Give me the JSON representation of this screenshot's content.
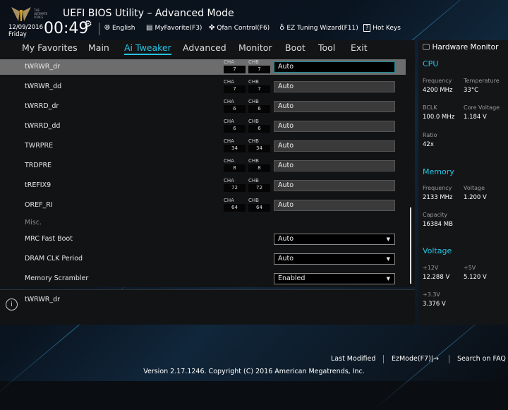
{
  "header": {
    "title": "UEFI BIOS Utility – Advanced Mode",
    "date": "12/09/2016",
    "day": "Friday",
    "time": "00:49",
    "toolbar": [
      {
        "label": "English",
        "icon": "globe-icon"
      },
      {
        "label": "MyFavorite(F3)",
        "icon": "favorite-list-icon"
      },
      {
        "label": "Qfan Control(F6)",
        "icon": "fan-icon"
      },
      {
        "label": "EZ Tuning Wizard(F11)",
        "icon": "lightbulb-icon"
      },
      {
        "label": "Hot Keys",
        "icon": "question-icon"
      }
    ]
  },
  "nav": {
    "tabs": [
      "My Favorites",
      "Main",
      "Ai Tweaker",
      "Advanced",
      "Monitor",
      "Boot",
      "Tool",
      "Exit"
    ],
    "active": "Ai Tweaker"
  },
  "rows": [
    {
      "label": "tWRWR_dr",
      "cha": "7",
      "chb": "7",
      "value": "Auto"
    },
    {
      "label": "tWRWR_dd",
      "cha": "7",
      "chb": "7",
      "value": "Auto"
    },
    {
      "label": "tWRRD_dr",
      "cha": "6",
      "chb": "6",
      "value": "Auto"
    },
    {
      "label": "tWRRD_dd",
      "cha": "6",
      "chb": "6",
      "value": "Auto"
    },
    {
      "label": "TWRPRE",
      "cha": "34",
      "chb": "34",
      "value": "Auto"
    },
    {
      "label": "TRDPRE",
      "cha": "8",
      "chb": "8",
      "value": "Auto"
    },
    {
      "label": "tREFIX9",
      "cha": "72",
      "chb": "72",
      "value": "Auto"
    },
    {
      "label": "OREF_RI",
      "cha": "64",
      "chb": "64",
      "value": "Auto"
    }
  ],
  "cha_label": "CHA",
  "chb_label": "CHB",
  "misc": "Misc.",
  "dropdowns": [
    {
      "label": "MRC Fast Boot",
      "value": "Auto"
    },
    {
      "label": "DRAM CLK Period",
      "value": "Auto"
    },
    {
      "label": "Memory Scrambler",
      "value": "Enabled"
    }
  ],
  "help": "tWRWR_dr",
  "hw": {
    "title": "Hardware Monitor",
    "cpu": {
      "title": "CPU",
      "frequency_label": "Frequency",
      "frequency": "4200 MHz",
      "temperature_label": "Temperature",
      "temperature": "33°C",
      "bclk_label": "BCLK",
      "bclk": "100.0 MHz",
      "core_voltage_label": "Core Voltage",
      "core_voltage": "1.184 V",
      "ratio_label": "Ratio",
      "ratio": "42x"
    },
    "memory": {
      "title": "Memory",
      "frequency_label": "Frequency",
      "frequency": "2133 MHz",
      "voltage_label": "Voltage",
      "voltage": "1.200 V",
      "capacity_label": "Capacity",
      "capacity": "16384 MB"
    },
    "voltage": {
      "title": "Voltage",
      "v12_label": "+12V",
      "v12": "12.288 V",
      "v5_label": "+5V",
      "v5": "5.120 V",
      "v33_label": "+3.3V",
      "v33": "3.376 V"
    }
  },
  "footer": {
    "last_modified": "Last Modified",
    "ezmode": "EzMode(F7)|→",
    "search": "Search on FAQ",
    "copyright": "Version 2.17.1246. Copyright (C) 2016 American Megatrends, Inc."
  },
  "colors": {
    "accent": "#23c6e6",
    "selected_row": "#6d6d6d"
  }
}
